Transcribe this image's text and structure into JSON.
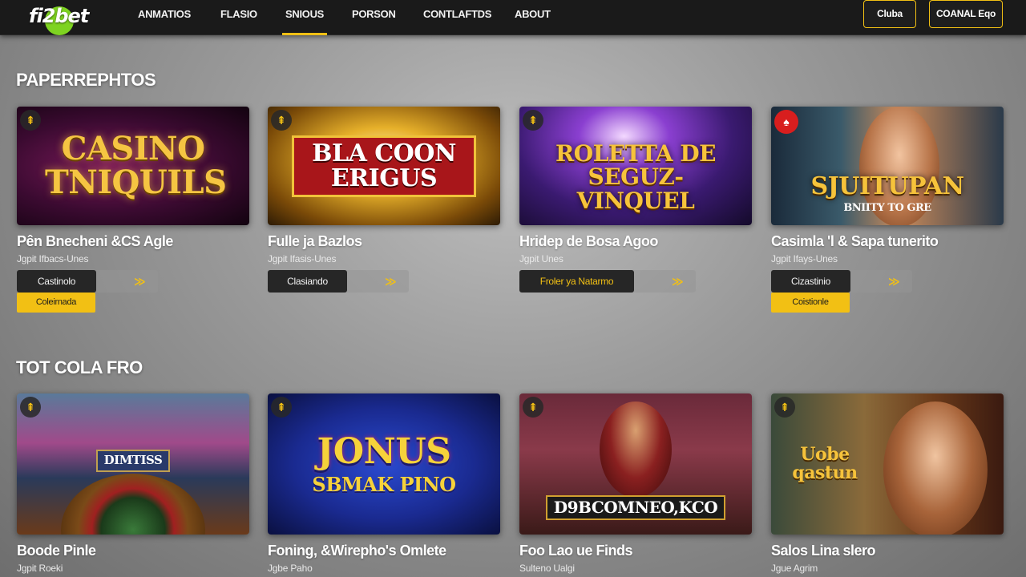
{
  "brand": {
    "logo_text": "fi2bet",
    "accent": "#f2c014",
    "logo_green": "#7ed321"
  },
  "nav": {
    "items": [
      {
        "label": "ANMATIOS"
      },
      {
        "label": "FLASIO"
      },
      {
        "label": "SNIOUS",
        "active": true
      },
      {
        "label": "PORSON"
      },
      {
        "label": "CONTLAFTDS"
      },
      {
        "label": "ABOUT"
      }
    ],
    "club_button": "Cluba",
    "contact_button": "COANAL Eqo"
  },
  "sections": [
    {
      "title": "PAPERREPHTOS",
      "cards": [
        {
          "art_text": "CASINO TNIQUILS",
          "title": "Pên Bnecheni &CS Agle",
          "subtitle": "Jgpit Ifbacs-Unes",
          "dark_button": "Castinolo",
          "yellow_button": "Coleirnada"
        },
        {
          "art_text": "BLA COON ERIGUS",
          "title": "Fulle ja Bazlos",
          "subtitle": "Jgpit Ifasis-Unes",
          "dark_button": "Clasiando"
        },
        {
          "art_text": "ROLETTA DE SEGUZ-VINQUEL",
          "title": "Hridep de Bosa Agoo",
          "subtitle": "Jgpit Unes",
          "dark_button": "Froler ya Natarmo"
        },
        {
          "art_text": "SJUITUPAN",
          "art_subtext": "BNIITY TO GRE",
          "title": "Casimla 'l & Sapa tunerito",
          "subtitle": "Jgpit Ifays-Unes",
          "dark_button": "Cizastinio",
          "yellow_button": "Coistionle"
        }
      ]
    },
    {
      "title": "TOT COLA FRO",
      "cards": [
        {
          "art_text": "DIMTISS",
          "title": "Boode Pinle",
          "subtitle": "Jgpit Roeki"
        },
        {
          "art_text": "JONUS",
          "art_subtext": "SBMAK PINO",
          "title": "Foning, &Wirepho's Omlete",
          "subtitle": "Jgbe Paho"
        },
        {
          "art_text": "D9BCOMNEO,KCO",
          "title": "Foo Lao ue Finds",
          "subtitle": "Sulteno Ualgi"
        },
        {
          "art_text": "Uobe qastun",
          "title": "Salos Lina slero",
          "subtitle": "Jgue Agrim"
        }
      ]
    }
  ]
}
